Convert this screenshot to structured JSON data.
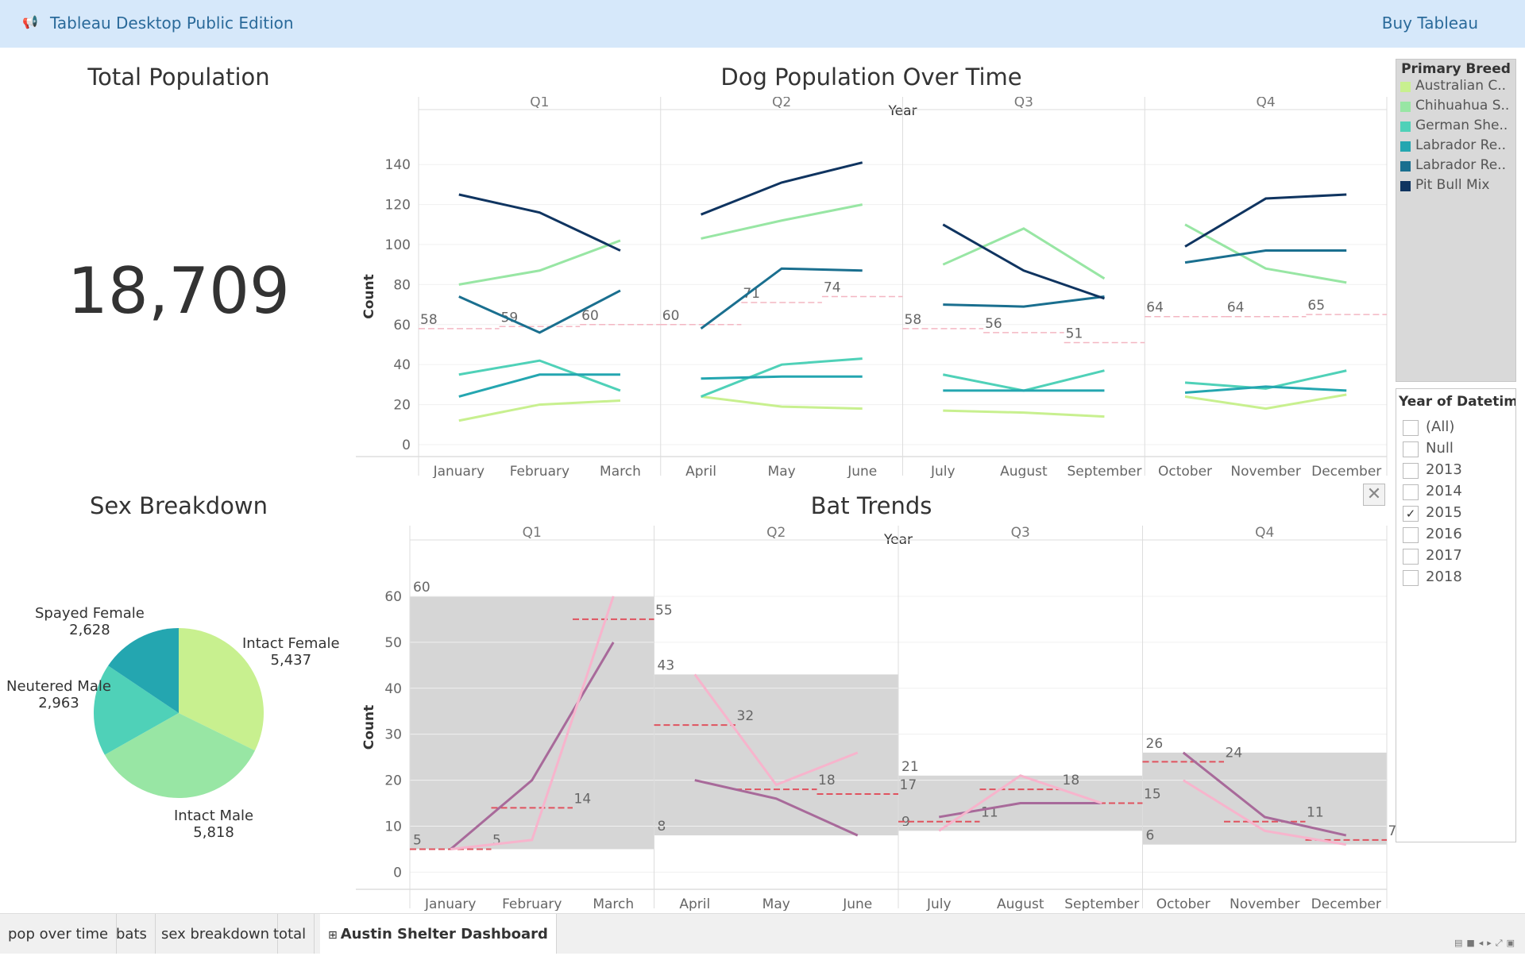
{
  "app": {
    "title": "Tableau Desktop Public Edition",
    "buy": "Buy Tableau"
  },
  "total": {
    "title": "Total Population",
    "value": "18,709"
  },
  "sex": {
    "title": "Sex Breakdown",
    "slices": [
      {
        "name": "Intact Female",
        "value": 5437,
        "label": "5,437",
        "color": "#c8f08f"
      },
      {
        "name": "Intact Male",
        "value": 5818,
        "label": "5,818",
        "color": "#98e6a4"
      },
      {
        "name": "Neutered Male",
        "value": 2963,
        "label": "2,963",
        "color": "#4fd1b8"
      },
      {
        "name": "Spayed Female",
        "value": 2628,
        "label": "2,628",
        "color": "#24a6b0"
      }
    ]
  },
  "legend": {
    "title": "Primary Breed",
    "items": [
      {
        "label": "Australian C..",
        "color": "#c8f08f"
      },
      {
        "label": "Chihuahua S..",
        "color": "#98e6a4"
      },
      {
        "label": "German She..",
        "color": "#4fd1b8"
      },
      {
        "label": "Labrador Re..",
        "color": "#24a6b0"
      },
      {
        "label": "Labrador Re..",
        "color": "#1a6f8f"
      },
      {
        "label": "Pit Bull Mix",
        "color": "#0f3460"
      }
    ]
  },
  "filter": {
    "title": "Year of Datetim..",
    "options": [
      {
        "label": "(All)",
        "checked": false
      },
      {
        "label": "Null",
        "checked": false
      },
      {
        "label": "2013",
        "checked": false
      },
      {
        "label": "2014",
        "checked": false
      },
      {
        "label": "2015",
        "checked": true
      },
      {
        "label": "2016",
        "checked": false
      },
      {
        "label": "2017",
        "checked": false
      },
      {
        "label": "2018",
        "checked": false
      }
    ]
  },
  "tabs": [
    "pop over time",
    "bats",
    "sex breakdown",
    "total",
    "Austin Shelter Dashboard"
  ],
  "active_tab": "Austin Shelter Dashboard",
  "chart_data": [
    {
      "type": "line",
      "title": "Dog Population Over Time",
      "header": "Year",
      "ylabel": "Count",
      "quarters": [
        "Q1",
        "Q2",
        "Q3",
        "Q4"
      ],
      "categories": [
        "January",
        "February",
        "March",
        "April",
        "May",
        "June",
        "July",
        "August",
        "September",
        "October",
        "November",
        "December"
      ],
      "yticks": [
        0,
        20,
        40,
        60,
        80,
        100,
        120,
        140
      ],
      "ylim": [
        -2,
        150
      ],
      "series": [
        {
          "color": "#c8f08f",
          "values": [
            12,
            20,
            22,
            24,
            19,
            18,
            17,
            16,
            14,
            24,
            18,
            25
          ]
        },
        {
          "color": "#98e6a4",
          "values": [
            80,
            87,
            102,
            103,
            112,
            120,
            90,
            108,
            83,
            110,
            88,
            81
          ]
        },
        {
          "color": "#4fd1b8",
          "values": [
            35,
            42,
            27,
            24,
            40,
            43,
            35,
            27,
            37,
            31,
            28,
            37
          ]
        },
        {
          "color": "#24a6b0",
          "values": [
            24,
            35,
            35,
            33,
            34,
            34,
            27,
            27,
            27,
            26,
            29,
            27
          ]
        },
        {
          "color": "#1a6f8f",
          "values": [
            74,
            56,
            77,
            58,
            88,
            87,
            70,
            69,
            74,
            91,
            97,
            97
          ]
        },
        {
          "color": "#0f3460",
          "values": [
            125,
            116,
            97,
            115,
            131,
            141,
            110,
            87,
            73,
            99,
            123,
            125
          ]
        }
      ],
      "reference_lines": [
        58,
        59,
        60,
        60,
        71,
        74,
        58,
        56,
        51,
        64,
        64,
        65
      ],
      "reference_labels": [
        "58",
        "59",
        "60",
        "60",
        "71",
        "74",
        "58",
        "56",
        "51",
        "64",
        "64",
        "65"
      ]
    },
    {
      "type": "line",
      "title": "Bat Trends",
      "header": "Year",
      "ylabel": "Count",
      "quarters": [
        "Q1",
        "Q2",
        "Q3",
        "Q4"
      ],
      "categories": [
        "January",
        "February",
        "March",
        "April",
        "May",
        "June",
        "July",
        "August",
        "September",
        "October",
        "November",
        "December"
      ],
      "yticks": [
        0,
        10,
        20,
        30,
        40,
        50,
        60
      ],
      "ylim": [
        -2,
        65
      ],
      "series": [
        {
          "color": "#a86a9a",
          "values": [
            5,
            20,
            50,
            20,
            16,
            8,
            12,
            15,
            15,
            26,
            12,
            8
          ]
        },
        {
          "color": "#f7b4cc",
          "values": [
            5,
            7,
            60,
            43,
            19,
            26,
            9,
            21,
            15,
            20,
            9,
            6
          ]
        }
      ],
      "quarter_bands": [
        {
          "min": 5,
          "max": 60,
          "min_label": "5",
          "max_label": "60"
        },
        {
          "min": 8,
          "max": 43,
          "min_label": "8",
          "max_label": "43"
        },
        {
          "min": 9,
          "max": 21,
          "min_label": "9",
          "max_label": "21"
        },
        {
          "min": 6,
          "max": 26,
          "min_label": "6",
          "max_label": "26"
        }
      ],
      "reference_lines": [
        5,
        14,
        55,
        32,
        18,
        17,
        11,
        18,
        15,
        24,
        11,
        7
      ],
      "reference_labels": [
        "5",
        "14",
        "55",
        "32",
        "18",
        "17",
        "11",
        "18",
        "15",
        "24",
        "11",
        "7"
      ]
    }
  ]
}
